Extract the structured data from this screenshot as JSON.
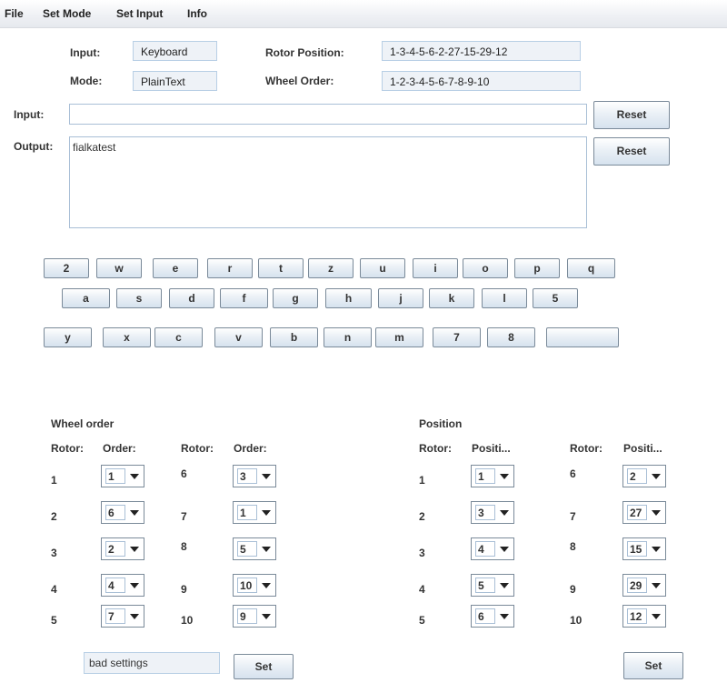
{
  "menu": [
    "File",
    "Set Mode",
    "Set Input",
    "Info"
  ],
  "info": {
    "input_label": "Input:",
    "input_value": "Keyboard",
    "mode_label": "Mode:",
    "mode_value": "PlainText",
    "rotor_pos_label": "Rotor Position:",
    "rotor_pos_value": "1-3-4-5-6-2-27-15-29-12",
    "wheel_order_label": "Wheel Order:",
    "wheel_order_value": "1-2-3-4-5-6-7-8-9-10"
  },
  "input_field": {
    "label": "Input:",
    "value": "",
    "reset_label": "Reset"
  },
  "output_field": {
    "label": "Output:",
    "value": "fialkatest",
    "reset_label": "Reset"
  },
  "keyboard": {
    "row1": [
      "2",
      "w",
      "e",
      "r",
      "t",
      "z",
      "u",
      "i",
      "o",
      "p",
      "q"
    ],
    "row2": [
      "a",
      "s",
      "d",
      "f",
      "g",
      "h",
      "j",
      "k",
      "l",
      "5"
    ],
    "row3": [
      "y",
      "x",
      "c",
      "v",
      "b",
      "n",
      "m",
      "7",
      "8",
      ""
    ]
  },
  "wheel_order": {
    "title": "Wheel order",
    "rotor_header": "Rotor:",
    "value_header": "Order:",
    "left": [
      {
        "rotor": "1",
        "value": "1"
      },
      {
        "rotor": "2",
        "value": "6"
      },
      {
        "rotor": "3",
        "value": "2"
      },
      {
        "rotor": "4",
        "value": "4"
      },
      {
        "rotor": "5",
        "value": "7"
      }
    ],
    "right": [
      {
        "rotor": "6",
        "value": "3"
      },
      {
        "rotor": "7",
        "value": "1"
      },
      {
        "rotor": "8",
        "value": "5"
      },
      {
        "rotor": "9",
        "value": "10"
      },
      {
        "rotor": "10",
        "value": "9"
      }
    ],
    "status": "bad settings",
    "set_label": "Set"
  },
  "position": {
    "title": "Position",
    "rotor_header": "Rotor:",
    "value_header": "Positi...",
    "left": [
      {
        "rotor": "1",
        "value": "1"
      },
      {
        "rotor": "2",
        "value": "3"
      },
      {
        "rotor": "3",
        "value": "4"
      },
      {
        "rotor": "4",
        "value": "5"
      },
      {
        "rotor": "5",
        "value": "6"
      }
    ],
    "right": [
      {
        "rotor": "6",
        "value": "2"
      },
      {
        "rotor": "7",
        "value": "27"
      },
      {
        "rotor": "8",
        "value": "15"
      },
      {
        "rotor": "9",
        "value": "29"
      },
      {
        "rotor": "10",
        "value": "12"
      }
    ],
    "set_label": "Set"
  }
}
